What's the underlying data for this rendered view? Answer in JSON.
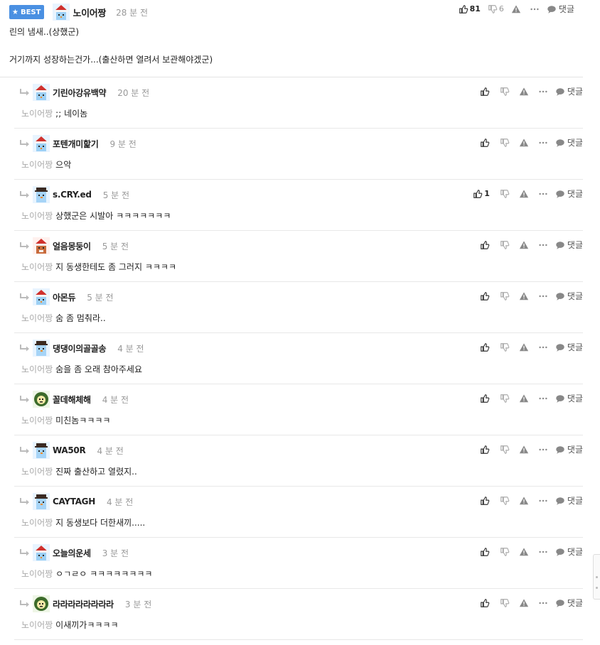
{
  "main": {
    "badge": "BEST",
    "author": "노이어짱",
    "time": "28 분 전",
    "body_lines": [
      "린의 냄새..(상했군)",
      "거기까지 성장하는건가...(출산하면 열려서 보관해야겠군)"
    ],
    "likes": "81",
    "dislikes": "6",
    "reply_label": "댓글"
  },
  "colors": {
    "badge": "#4a90e2",
    "accent": "#222222"
  },
  "icons": {
    "like": "thumb-up-icon",
    "dislike": "thumb-down-icon",
    "report": "warning-icon",
    "more": "more-icon",
    "reply": "comment-bubble-icon",
    "arrow": "reply-arrow-icon"
  },
  "replies": [
    {
      "author": "기린아강유백약",
      "time": "20 분 전",
      "mention": "노이어짱",
      "text": ";; 네이놈",
      "likes": "",
      "avatar": "santa"
    },
    {
      "author": "포텐개미핥기",
      "time": "9 분 전",
      "mention": "노이어짱",
      "text": "으악",
      "likes": "",
      "avatar": "santa"
    },
    {
      "author": "s.CRY.ed",
      "time": "5 분 전",
      "mention": "노이어짱",
      "text": "상했군은 시발아 ㅋㅋㅋㅋㅋㅋㅋ",
      "likes": "1",
      "avatar": "snowman"
    },
    {
      "author": "얼음몽둥이",
      "time": "5 분 전",
      "mention": "노이어짱",
      "text": "지 동생한테도 좀 그러지 ㅋㅋㅋㅋ",
      "likes": "",
      "avatar": "santa-red"
    },
    {
      "author": "아몬듀",
      "time": "5 분 전",
      "mention": "노이어짱",
      "text": "숨 좀 멈춰라..",
      "likes": "",
      "avatar": "santa"
    },
    {
      "author": "댕댕이의골골송",
      "time": "4 분 전",
      "mention": "노이어짱",
      "text": "숨을 좀 오래 참아주세요",
      "likes": "",
      "avatar": "snowman"
    },
    {
      "author": "꼴데해체해",
      "time": "4 분 전",
      "mention": "노이어짱",
      "text": "미친놈ㅋㅋㅋㅋ",
      "likes": "",
      "avatar": "green"
    },
    {
      "author": "WA50R",
      "time": "4 분 전",
      "mention": "노이어짱",
      "text": "진짜 출산하고 열렸지..",
      "likes": "",
      "avatar": "snowman"
    },
    {
      "author": "CAYTAGH",
      "time": "4 분 전",
      "mention": "노이어짱",
      "text": "지 동생보다 더한새끼.....",
      "likes": "",
      "avatar": "snowman"
    },
    {
      "author": "오늘의운세",
      "time": "3 분 전",
      "mention": "노이어짱",
      "text": "ㅇㄱㄹㅇ ㅋㅋㅋㅋㅋㅋㅋㅋ",
      "likes": "",
      "avatar": "santa"
    },
    {
      "author": "라라라라라라라라",
      "time": "3 분 전",
      "mention": "노이어짱",
      "text": "이새끼가ㅋㅋㅋㅋ",
      "likes": "",
      "avatar": "green"
    }
  ]
}
